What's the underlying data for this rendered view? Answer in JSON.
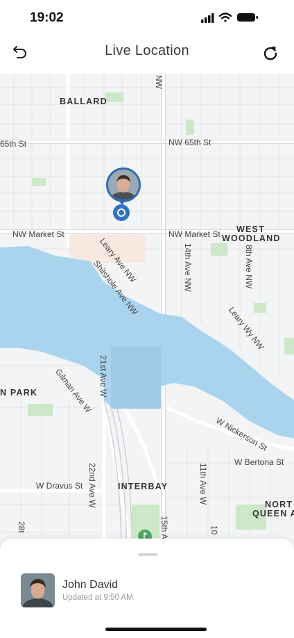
{
  "status_bar": {
    "time": "19:02"
  },
  "header": {
    "title": "Live Location"
  },
  "map": {
    "labels": {
      "ballard": "BALLARD",
      "nw65_left": "65th St",
      "nw65_right": "NW 65th St",
      "market_left": "NW Market St",
      "market_right": "NW Market St",
      "west": "WEST",
      "woodland": "WOODLAND",
      "nw_vertical": "NW",
      "ave14": "14th Ave NW",
      "ave8": "8th Ave NW",
      "leary_nw": "Leary Ave NW",
      "shilshole": "Shilshole Ave NW",
      "leary_way": "Leary Wy NW",
      "ave21": "21st Ave W",
      "park": "N PARK",
      "gilman": "Gilman Ave W",
      "nickerson": "W Nickerson St",
      "bertona": "W Bertona St",
      "dravus": "W Dravus St",
      "ave22": "22nd Ave W",
      "interbay": "INTERBAY",
      "ave11": "11th Ave W",
      "north": "NORT",
      "queen_anne": "QUEEN AN",
      "ave15": "15th A",
      "ave28": "28t",
      "ave10": "10"
    }
  },
  "contact": {
    "name": "John David",
    "updated": "Updated at 9:50 AM"
  },
  "colors": {
    "water": "#aad3ee",
    "map_bg": "#f3f4f6",
    "road": "#ffffff",
    "marker": "#2f74c0"
  }
}
